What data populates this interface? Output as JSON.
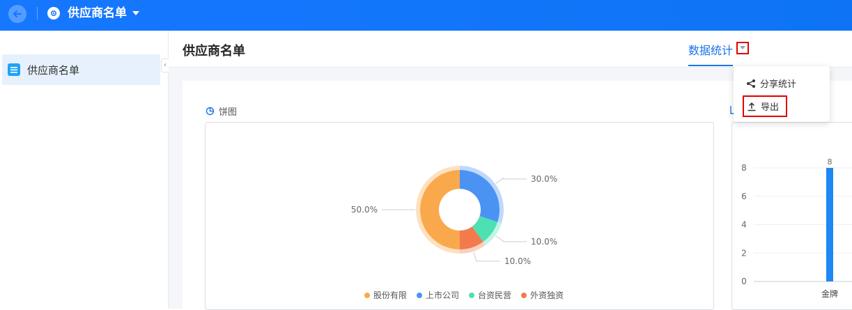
{
  "app": {
    "title": "供应商名单"
  },
  "sidebar": {
    "items": [
      {
        "label": "供应商名单"
      }
    ]
  },
  "header": {
    "title": "供应商名单",
    "tab_label": "数据统计"
  },
  "menu": {
    "share_label": "分享统计",
    "export_label": "导出"
  },
  "pie_section": {
    "title": "饼图"
  },
  "colors": {
    "brand": "#1677ff",
    "pie": [
      "#f9a94b",
      "#4b93f3",
      "#4de0b3",
      "#f27a4c"
    ],
    "bar": "#1e88f5"
  },
  "chart_data": [
    {
      "type": "pie",
      "title": "",
      "categories": [
        "股份有限",
        "上市公司",
        "台资民营",
        "外资独资"
      ],
      "values": [
        50.0,
        30.0,
        10.0,
        10.0
      ],
      "labels": [
        "50.0%",
        "30.0%",
        "10.0%",
        "10.0%"
      ],
      "donut": true,
      "legend": "bottom"
    },
    {
      "type": "bar",
      "title": "",
      "categories": [
        "金牌"
      ],
      "values": [
        8
      ],
      "data_labels": [
        "8"
      ],
      "yticks": [
        "0",
        "2",
        "4",
        "6",
        "8"
      ],
      "ylim": [
        0,
        8
      ],
      "grid": true
    }
  ]
}
